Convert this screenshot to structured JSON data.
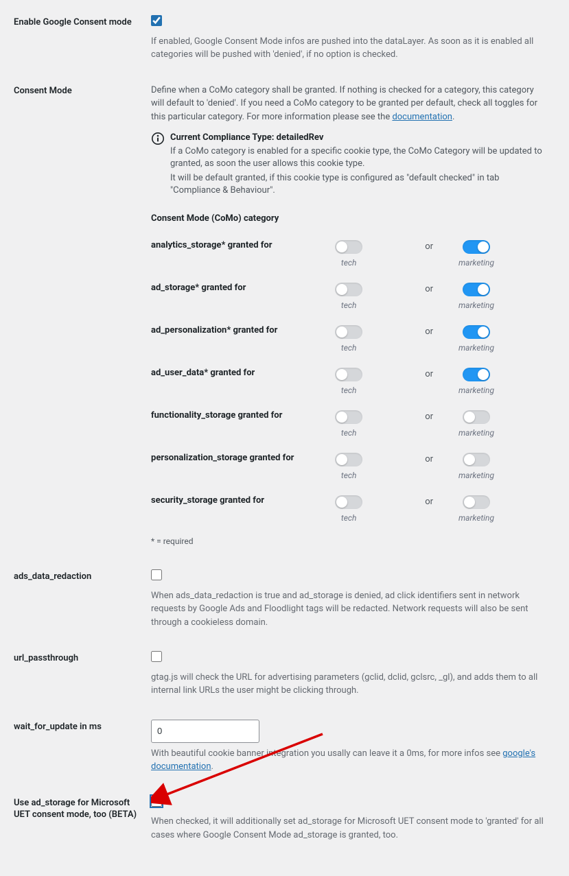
{
  "rows": {
    "enable": {
      "label": "Enable Google Consent mode",
      "checked": true,
      "desc": "If enabled, Google Consent Mode infos are pushed into the dataLayer. As soon as it is enabled all categories will be pushed with 'denied', if no option is checked."
    },
    "mode": {
      "label": "Consent Mode",
      "desc_pre": "Define when a CoMo category shall be granted. If nothing is checked for a category, this category will default to 'denied'. If you need a CoMo category to be granted per default, check all toggles for this particular category. For more information please see the ",
      "desc_link": "documentation",
      "info_title": "Current Compliance Type: detailedRev",
      "info_line1": "If a CoMo category is enabled for a specific cookie type, the CoMo Category will be updated to granted, as soon the user allows this cookie type.",
      "info_line2": "It will be default granted, if this cookie type is configured as \"default checked\" in tab \"Compliance & Behaviour\".",
      "como_heading": "Consent Mode (CoMo) category",
      "col_tech": "tech",
      "col_marketing": "marketing",
      "or": "or",
      "footnote": "* = required",
      "categories": [
        {
          "label": "analytics_storage* granted for",
          "tech": false,
          "marketing": true
        },
        {
          "label": "ad_storage* granted for",
          "tech": false,
          "marketing": true
        },
        {
          "label": "ad_personalization* granted for",
          "tech": false,
          "marketing": true
        },
        {
          "label": "ad_user_data* granted for",
          "tech": false,
          "marketing": true
        },
        {
          "label": "functionality_storage granted for",
          "tech": false,
          "marketing": false
        },
        {
          "label": "personalization_storage granted for",
          "tech": false,
          "marketing": false
        },
        {
          "label": "security_storage granted for",
          "tech": false,
          "marketing": false
        }
      ]
    },
    "redaction": {
      "label": "ads_data_redaction",
      "checked": false,
      "desc": "When ads_data_redaction is true and ad_storage is denied, ad click identifiers sent in network requests by Google Ads and Floodlight tags will be redacted. Network requests will also be sent through a cookieless domain."
    },
    "passthrough": {
      "label": "url_passthrough",
      "checked": false,
      "desc": "gtag.js will check the URL for advertising parameters (gclid, dclid, gclsrc, _gl), and adds them to all internal link URLs the user might be clicking through."
    },
    "wait": {
      "label": "wait_for_update in ms",
      "value": "0",
      "desc_pre": "With beautiful cookie banner integration you usally can leave it a 0ms, for more infos see ",
      "desc_link": "google's documentation"
    },
    "uet": {
      "label": "Use ad_storage for Microsoft UET consent mode, too (BETA)",
      "checked": false,
      "desc": "When checked, it will additionally set ad_storage for Microsoft UET consent mode to 'granted' for all cases where Google Consent Mode ad_storage is granted, too."
    }
  }
}
